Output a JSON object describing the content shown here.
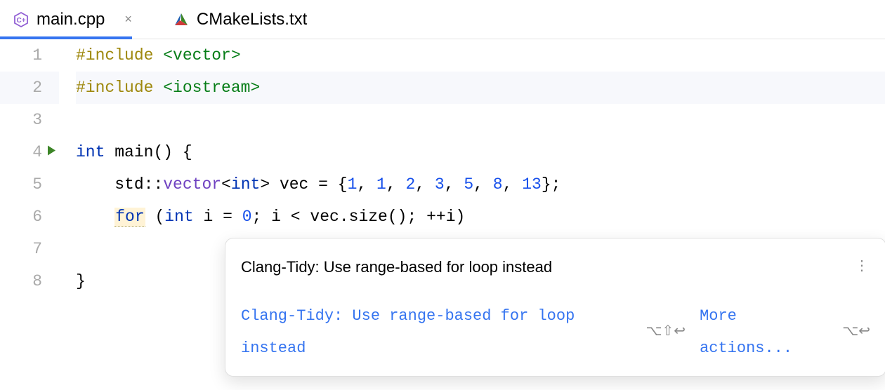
{
  "tabs": [
    {
      "label": "main.cpp",
      "active": true
    },
    {
      "label": "CMakeLists.txt",
      "active": false
    }
  ],
  "lines": {
    "l1": {
      "num": "1"
    },
    "l2": {
      "num": "2"
    },
    "l3": {
      "num": "3"
    },
    "l4": {
      "num": "4"
    },
    "l5": {
      "num": "5"
    },
    "l6": {
      "num": "6"
    },
    "l7": {
      "num": "7"
    },
    "l8": {
      "num": "8"
    }
  },
  "code": {
    "include": "#include",
    "vector_hdr": "<vector>",
    "iostream_hdr": "<iostream>",
    "int": "int",
    "main": "main",
    "lparen": "(",
    "rparen": ")",
    "lbrace": "{",
    "rbrace": "}",
    "std": "std",
    "scope": "::",
    "vector": "vector",
    "lt": "<",
    "gt": ">",
    "vec": "vec",
    "eq": " = ",
    "n1": "1",
    "n2": "2",
    "n3": "3",
    "n5": "5",
    "n8": "8",
    "n13": "13",
    "comma": ",",
    "semi": ";",
    "for": "for",
    "sp": " ",
    "i": "i",
    "zero": "0",
    "less": " < ",
    "dot": ".",
    "size": "size",
    "inc_op": "++",
    "close_brace": "}"
  },
  "tooltip": {
    "title": "Clang-Tidy: Use range-based for loop instead",
    "link": "Clang-Tidy: Use range-based for loop instead",
    "shortcut1": "⌥⇧↩",
    "more": "More actions...",
    "shortcut2": "⌥↩"
  }
}
